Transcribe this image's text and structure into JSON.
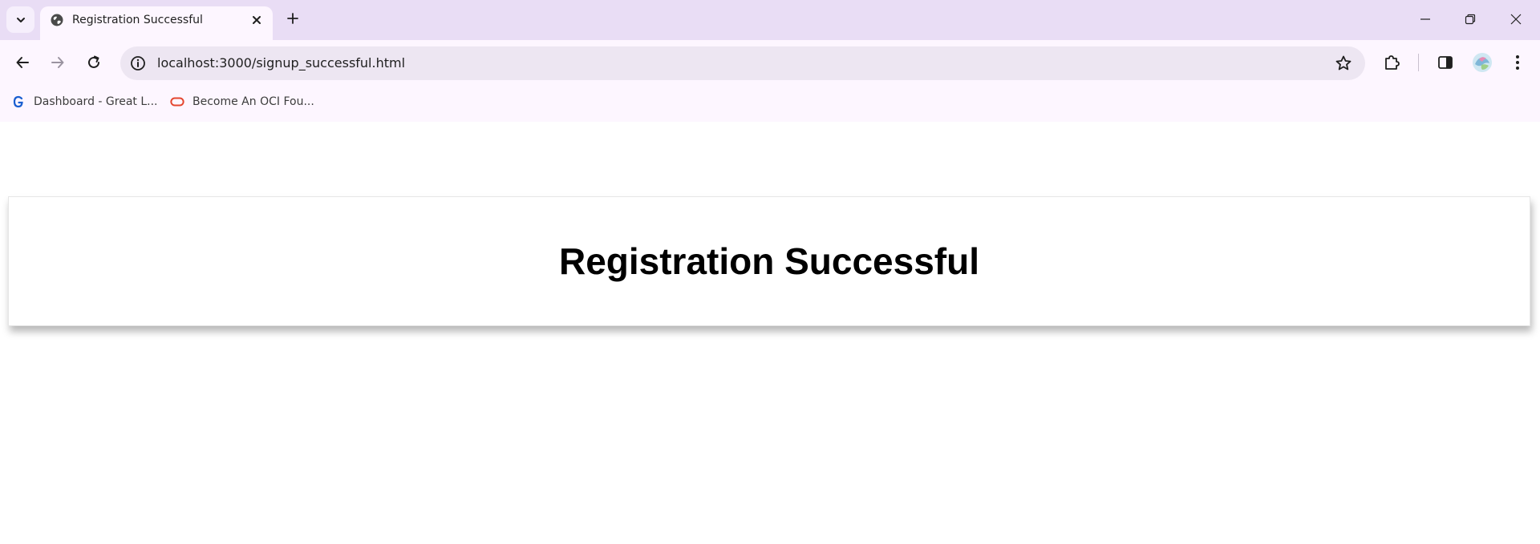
{
  "browser": {
    "tab": {
      "title": "Registration Successful"
    },
    "address_bar": {
      "url": "localhost:3000/signup_successful.html"
    },
    "bookmarks": [
      {
        "label": "Dashboard - Great L...",
        "icon": "great-learning-icon"
      },
      {
        "label": "Become An OCI Fou...",
        "icon": "oracle-icon"
      }
    ]
  },
  "page": {
    "heading": "Registration Successful"
  },
  "colors": {
    "titlebar": "#e9ddf5",
    "toolbar": "#fdf6ff",
    "omnibox": "#ede6f2",
    "oracle_red": "#e4462f",
    "google_blue": "#1a5fd0"
  }
}
